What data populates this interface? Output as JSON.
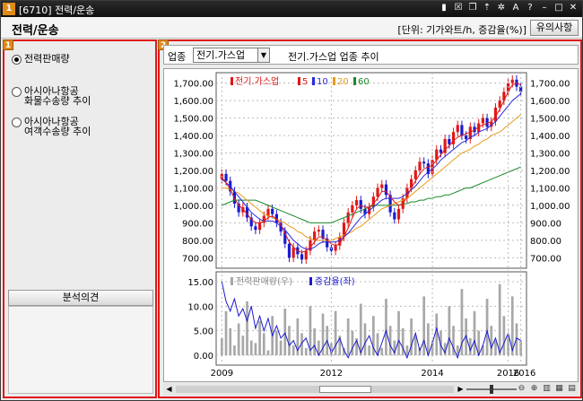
{
  "window": {
    "badge": "1",
    "title": "[6710] 전력/운송"
  },
  "header": {
    "title": "전력/운송",
    "unit": "[단위: 기가와트/h, 증감율(%)]",
    "notice_button": "유의사항"
  },
  "left_panel": {
    "marker": "1",
    "options": [
      {
        "label": "전력판매량",
        "checked": true
      },
      {
        "label": "아시아나항공\n화물수송량 추이",
        "checked": false
      },
      {
        "label": "아시아나항공\n여객수송량 추이",
        "checked": false
      }
    ],
    "analysis_title": "분석의견"
  },
  "right_panel": {
    "marker": "2",
    "industry_label": "업종",
    "industry_value": "전기.가스업",
    "chart_title": "전기.가스업 업종 추이"
  },
  "colors": {
    "up": "#e01818",
    "down": "#1a1ad0",
    "ma5": "#e01818",
    "ma10": "#2a2ae0",
    "ma20": "#e89a18",
    "ma60": "#1a8a2a",
    "bar": "#a8a8a8",
    "accent": "#e01818"
  },
  "chart_data": [
    {
      "type": "candlestick",
      "legend": [
        "전기.가스업",
        "5",
        "10",
        "20",
        "60"
      ],
      "yticks": [
        700,
        800,
        900,
        1000,
        1100,
        1200,
        1300,
        1400,
        1500,
        1600,
        1700
      ],
      "ytick_labels": [
        "700.00",
        "800.00",
        "900.00",
        "1,000.00",
        "1,100.00",
        "1,200.00",
        "1,300.00",
        "1,400.00",
        "1,500.00",
        "1,600.00",
        "1,700.00"
      ],
      "ylim": [
        640,
        1760
      ],
      "close": [
        1180,
        1140,
        1080,
        1010,
        960,
        990,
        930,
        880,
        860,
        900,
        940,
        980,
        950,
        900,
        850,
        780,
        700,
        760,
        720,
        690,
        740,
        800,
        850,
        860,
        810,
        760,
        740,
        770,
        820,
        900,
        960,
        1000,
        1030,
        980,
        950,
        990,
        1050,
        1100,
        1120,
        1060,
        960,
        920,
        980,
        1040,
        1100,
        1150,
        1200,
        1250,
        1240,
        1180,
        1260,
        1320,
        1300,
        1380,
        1350,
        1420,
        1460,
        1400,
        1380,
        1450,
        1420,
        1470,
        1500,
        1450,
        1480,
        1560,
        1600,
        1650,
        1700,
        1720,
        1680,
        1650
      ],
      "ma5": [
        1160,
        1130,
        1090,
        1040,
        1000,
        980,
        950,
        920,
        900,
        900,
        910,
        930,
        940,
        920,
        890,
        840,
        790,
        760,
        740,
        730,
        740,
        760,
        790,
        820,
        820,
        800,
        780,
        770,
        780,
        820,
        870,
        930,
        980,
        1000,
        990,
        990,
        1010,
        1040,
        1080,
        1080,
        1050,
        1020,
        1000,
        1010,
        1050,
        1100,
        1140,
        1180,
        1210,
        1220,
        1230,
        1260,
        1290,
        1320,
        1340,
        1370,
        1390,
        1400,
        1410,
        1420,
        1430,
        1450,
        1460,
        1470,
        1480,
        1510,
        1550,
        1600,
        1650,
        1690,
        1700,
        1690
      ],
      "ma10": [
        1150,
        1130,
        1110,
        1080,
        1050,
        1020,
        990,
        960,
        940,
        920,
        910,
        910,
        910,
        900,
        880,
        860,
        830,
        800,
        780,
        760,
        750,
        750,
        760,
        780,
        790,
        790,
        790,
        790,
        800,
        820,
        840,
        870,
        900,
        930,
        950,
        970,
        990,
        1010,
        1030,
        1040,
        1040,
        1040,
        1040,
        1050,
        1070,
        1090,
        1110,
        1140,
        1170,
        1190,
        1210,
        1230,
        1260,
        1280,
        1300,
        1320,
        1340,
        1360,
        1370,
        1390,
        1400,
        1420,
        1430,
        1440,
        1460,
        1480,
        1510,
        1540,
        1570,
        1600,
        1620,
        1640
      ],
      "ma20": [
        1100,
        1100,
        1090,
        1080,
        1070,
        1050,
        1030,
        1010,
        990,
        970,
        950,
        940,
        930,
        920,
        910,
        900,
        880,
        870,
        850,
        840,
        820,
        810,
        800,
        800,
        800,
        800,
        800,
        810,
        820,
        830,
        840,
        850,
        870,
        880,
        900,
        920,
        940,
        960,
        980,
        990,
        1000,
        1010,
        1020,
        1030,
        1040,
        1060,
        1080,
        1100,
        1120,
        1140,
        1160,
        1180,
        1200,
        1220,
        1240,
        1260,
        1280,
        1300,
        1310,
        1320,
        1340,
        1350,
        1370,
        1380,
        1400,
        1410,
        1420,
        1440,
        1460,
        1480,
        1500,
        1520
      ],
      "ma60": [
        1000,
        1010,
        1020,
        1030,
        1030,
        1030,
        1030,
        1030,
        1030,
        1020,
        1010,
        1000,
        990,
        980,
        970,
        960,
        950,
        940,
        930,
        920,
        910,
        900,
        900,
        900,
        900,
        900,
        900,
        910,
        920,
        930,
        940,
        950,
        960,
        970,
        980,
        990,
        1000,
        1000,
        1000,
        1000,
        1000,
        1000,
        1000,
        1010,
        1010,
        1020,
        1020,
        1030,
        1030,
        1040,
        1040,
        1050,
        1050,
        1060,
        1060,
        1070,
        1080,
        1090,
        1100,
        1100,
        1110,
        1120,
        1130,
        1140,
        1150,
        1160,
        1170,
        1180,
        1190,
        1200,
        1210,
        1220
      ]
    },
    {
      "type": "bar+line",
      "legend": [
        "전력판매량(우)",
        "증감율(좌)"
      ],
      "yticks": [
        0,
        5,
        10,
        15
      ],
      "ytick_labels": [
        "0.00",
        "5.00",
        "10.00",
        "15.00"
      ],
      "ylim": [
        -2,
        17
      ],
      "bars": [
        3.5,
        9.0,
        5.5,
        2.0,
        6.5,
        4.0,
        11.0,
        3.0,
        2.5,
        7.0,
        4.5,
        1.0,
        8.0,
        5.0,
        3.0,
        9.5,
        6.0,
        2.0,
        7.5,
        4.5,
        1.5,
        10.0,
        5.5,
        3.0,
        8.5,
        6.0,
        2.5,
        9.0,
        4.0,
        1.5,
        7.5,
        5.0,
        3.5,
        10.5,
        6.5,
        2.0,
        8.0,
        4.5,
        1.5,
        11.5,
        6.0,
        3.0,
        9.0,
        5.5,
        2.0,
        7.5,
        4.0,
        1.5,
        12.0,
        6.5,
        3.0,
        8.5,
        5.0,
        2.5,
        10.0,
        6.0,
        2.0,
        13.5,
        7.5,
        3.5,
        9.0,
        5.0,
        2.0,
        11.5,
        6.0,
        3.0,
        14.5,
        8.0,
        4.0,
        12.0,
        6.5,
        3.0
      ],
      "rate": [
        15.0,
        11.0,
        9.0,
        11.5,
        8.0,
        9.5,
        7.0,
        10.0,
        5.5,
        8.0,
        5.0,
        7.5,
        4.0,
        6.0,
        3.5,
        4.5,
        2.0,
        3.0,
        1.0,
        2.5,
        3.5,
        1.0,
        2.0,
        0.0,
        1.5,
        3.0,
        0.5,
        2.0,
        3.5,
        1.0,
        -0.5,
        1.5,
        3.0,
        0.5,
        2.5,
        4.0,
        1.5,
        0.0,
        2.5,
        5.0,
        2.0,
        0.5,
        3.0,
        1.5,
        -0.5,
        2.0,
        4.5,
        1.0,
        3.0,
        0.0,
        2.5,
        5.5,
        2.0,
        0.5,
        3.5,
        1.5,
        -0.5,
        2.5,
        4.0,
        1.0,
        3.0,
        0.0,
        2.0,
        5.0,
        1.5,
        3.5,
        0.5,
        2.5,
        4.5,
        1.0,
        3.5,
        3.0
      ]
    }
  ],
  "x_axis": [
    "2009",
    "2012",
    "2014",
    "2016",
    "2016"
  ],
  "toolbar_icons": [
    "zoom-out-icon",
    "zoom-in-icon",
    "bars-icon",
    "grid-icon",
    "settings-icon"
  ]
}
